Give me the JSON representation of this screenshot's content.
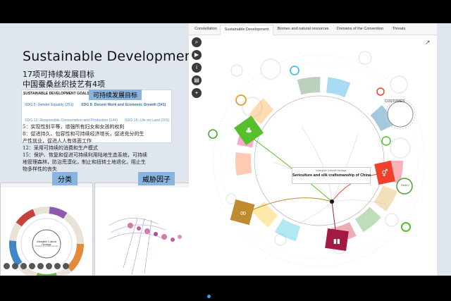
{
  "slide": {
    "title": "Sustainable Development",
    "subtitle_line1": "17项可持续发展目标",
    "subtitle_line2": "中国蚕桑丝织技艺有4项",
    "highlight_goals": "可持续发展目标",
    "sdg_box": {
      "header": "SUSTAINABLE DEVELOPMENT GOALS",
      "items": [
        {
          "label": "SDG 5: Gender Equality",
          "count": "(251)"
        },
        {
          "label": "SDG 8: Decent Work and Economic Growth",
          "count": "(341)"
        },
        {
          "label": "SDG 12: Responsible Consumption and Production",
          "count": "(144)"
        },
        {
          "label": "SDG 15: Life on Land",
          "count": "(101)"
        }
      ]
    },
    "goal_lines": [
      "5：实现性别平等，增强所有妇女和女孩的权利",
      "8：促进持久、包容性和可持续经济增长，促进充分的生",
      "产性就业，促进人人有体面工作",
      "12：采用可持续的消费和生产模式",
      "15：保护、恢复和促进可持续利用陆地生态系统，可持续",
      "地管理森林，防治荒漠化，制止和扭转土地退化，阻止生",
      "物多样性的丧失"
    ],
    "label_category": "分类",
    "label_threat": "威胁因子",
    "thumb_left_center": "Intangible Cultural Heritage",
    "thumb_left_sub": "Traditional craftsmanship"
  },
  "app": {
    "tabs": [
      "Constellation",
      "Sustainable Development",
      "Biomes and natural resources",
      "Domains of the Convention",
      "Threats"
    ],
    "active_tab": 1,
    "side_buttons": [
      "search-icon",
      "play-icon",
      "info-icon",
      "document-icon",
      "plus-icon"
    ],
    "center_small": "Intangible Cultural Heritage",
    "center_title": "Sericulture and silk craftsmanship of China",
    "node_costumes": "COSTUMES",
    "node_family": "FAMILY",
    "share_icon": "external-link-icon",
    "colors": {
      "sdg5": "#ef402b",
      "sdg8": "#a21942",
      "sdg12": "#bf8b2e",
      "sdg15": "#56c02b"
    }
  }
}
